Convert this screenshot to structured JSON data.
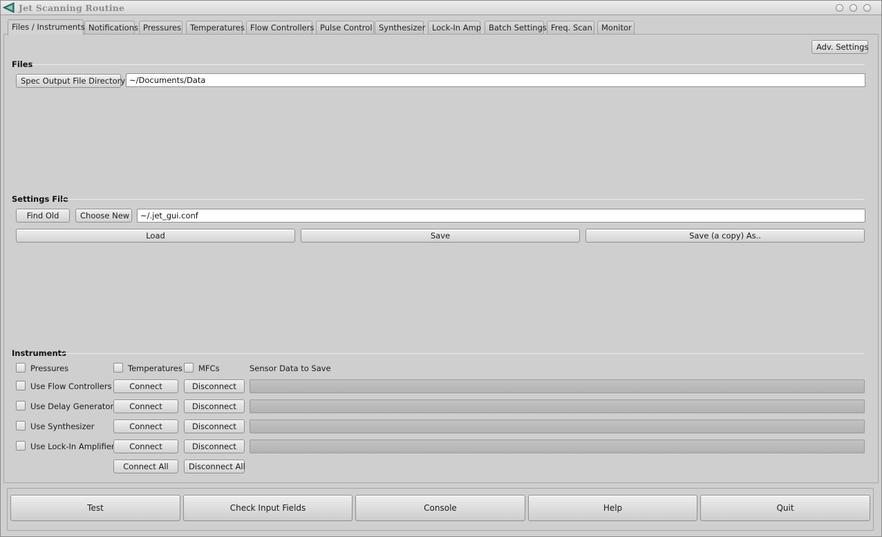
{
  "window": {
    "title": "Jet Scanning Routine"
  },
  "tabs": [
    {
      "label": "Files / Instruments",
      "active": true
    },
    {
      "label": "Notifications"
    },
    {
      "label": "Pressures"
    },
    {
      "label": "Temperatures"
    },
    {
      "label": "Flow Controllers"
    },
    {
      "label": "Pulse Control"
    },
    {
      "label": "Synthesizer"
    },
    {
      "label": "Lock-In Amp"
    },
    {
      "label": "Batch Settings"
    },
    {
      "label": "Freq. Scan"
    },
    {
      "label": "Monitor"
    }
  ],
  "adv_settings": "Adv. Settings",
  "files": {
    "section": "Files",
    "spec_dir_button": "Spec Output File Directory",
    "output_dir": "~/Documents/Data"
  },
  "settings_file": {
    "section": "Settings File",
    "find_old": "Find Old",
    "choose_new": "Choose New",
    "path": "~/.jet_gui.conf",
    "load": "Load",
    "save": "Save",
    "save_copy": "Save (a copy) As.."
  },
  "instruments": {
    "section": "Instruments",
    "sensors": {
      "pressures": "Pressures",
      "temperatures": "Temperatures",
      "mfcs": "MFCs",
      "sensor_label": "Sensor Data to Save"
    },
    "rows": [
      {
        "label": "Use Flow Controllers",
        "connect": "Connect",
        "disconnect": "Disconnect"
      },
      {
        "label": "Use Delay Generator",
        "connect": "Connect",
        "disconnect": "Disconnect"
      },
      {
        "label": "Use Synthesizer",
        "connect": "Connect",
        "disconnect": "Disconnect"
      },
      {
        "label": "Use Lock-In Amplifier",
        "connect": "Connect",
        "disconnect": "Disconnect"
      }
    ],
    "connect_all": "Connect All",
    "disconnect_all": "Disconnect All"
  },
  "bottom": {
    "test": "Test",
    "check": "Check Input Fields",
    "console": "Console",
    "help": "Help",
    "quit": "Quit"
  },
  "colors": {
    "window_bg": "#cfcfcf",
    "accent_icon": "#2a9a8a"
  }
}
